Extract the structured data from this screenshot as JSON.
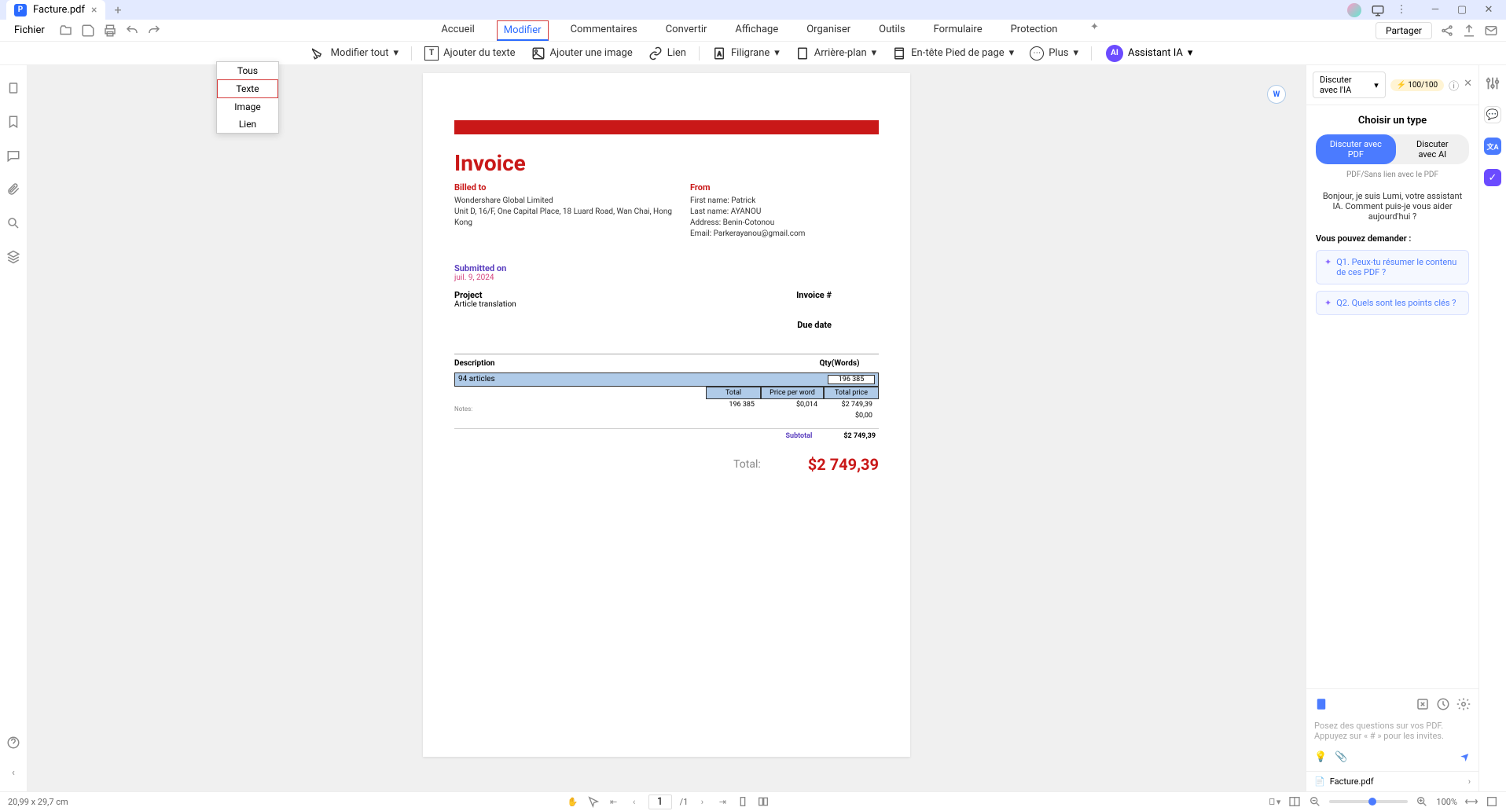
{
  "tab": {
    "title": "Facture.pdf"
  },
  "file_menu": "Fichier",
  "menu_tabs": [
    "Accueil",
    "Modifier",
    "Commentaires",
    "Convertir",
    "Affichage",
    "Organiser",
    "Outils",
    "Formulaire",
    "Protection"
  ],
  "share_label": "Partager",
  "toolbar": {
    "modify_all": "Modifier tout",
    "add_text": "Ajouter du texte",
    "add_image": "Ajouter une image",
    "link": "Lien",
    "watermark": "Filigrane",
    "background": "Arrière-plan",
    "header_footer": "En-tête Pied de page",
    "more": "Plus",
    "ai_assistant": "Assistant IA"
  },
  "dropdown": {
    "all": "Tous",
    "text": "Texte",
    "image": "Image",
    "link": "Lien"
  },
  "invoice": {
    "title": "Invoice",
    "billed_to": "Billed to",
    "billed_lines": "Wondershare Global Limited\nUnit D, 16/F, One Capital Place, 18 Luard Road, Wan Chai, Hong Kong",
    "from": "From",
    "from_fname": "First name: Patrick",
    "from_lname": "Last name: AYANOU",
    "from_addr": "Address: Benin-Cotonou",
    "from_email": "Email: Parkerayanou@gmail.com",
    "submitted": "Submitted on",
    "date": "juil. 9, 2024",
    "project": "Project",
    "project_name": "Article translation",
    "invoice_num": "Invoice #",
    "due_date": "Due date",
    "description": "Description",
    "qty": "Qty(Words)",
    "articles": "94 articles",
    "qty_val": "196 385",
    "total_h": "Total",
    "price_per": "Price per word",
    "total_price": "Total price",
    "tot_words": "196 385",
    "ppw": "$0,014",
    "line_total": "$2 749,39",
    "zero": "$0,00",
    "notes": "Notes:",
    "subtotal": "Subtotal",
    "subtotal_val": "$2 749,39",
    "total_label": "Total:",
    "total_val": "$2 749,39"
  },
  "ai": {
    "chat_label": "Discuter avec l'IA",
    "credits": "100/100",
    "choose_type": "Choisir un type",
    "chat_pdf": "Discuter avec PDF",
    "chat_ai": "Discuter avec AI",
    "sub": "PDF/Sans lien avec le PDF",
    "greeting": "Bonjour, je suis Lumi, votre assistant IA. Comment puis-je vous aider aujourd'hui ?",
    "ask_title": "Vous pouvez demander :",
    "q1": "Q1. Peux-tu résumer le contenu de ces PDF ?",
    "q2": "Q2. Quels sont les points clés ?",
    "placeholder": "Posez des questions sur vos PDF. Appuyez sur « # » pour les invites.",
    "file": "Facture.pdf"
  },
  "status": {
    "dimensions": "20,99 x 29,7 cm",
    "page": "1",
    "total_pages": "/1",
    "zoom": "100%"
  }
}
